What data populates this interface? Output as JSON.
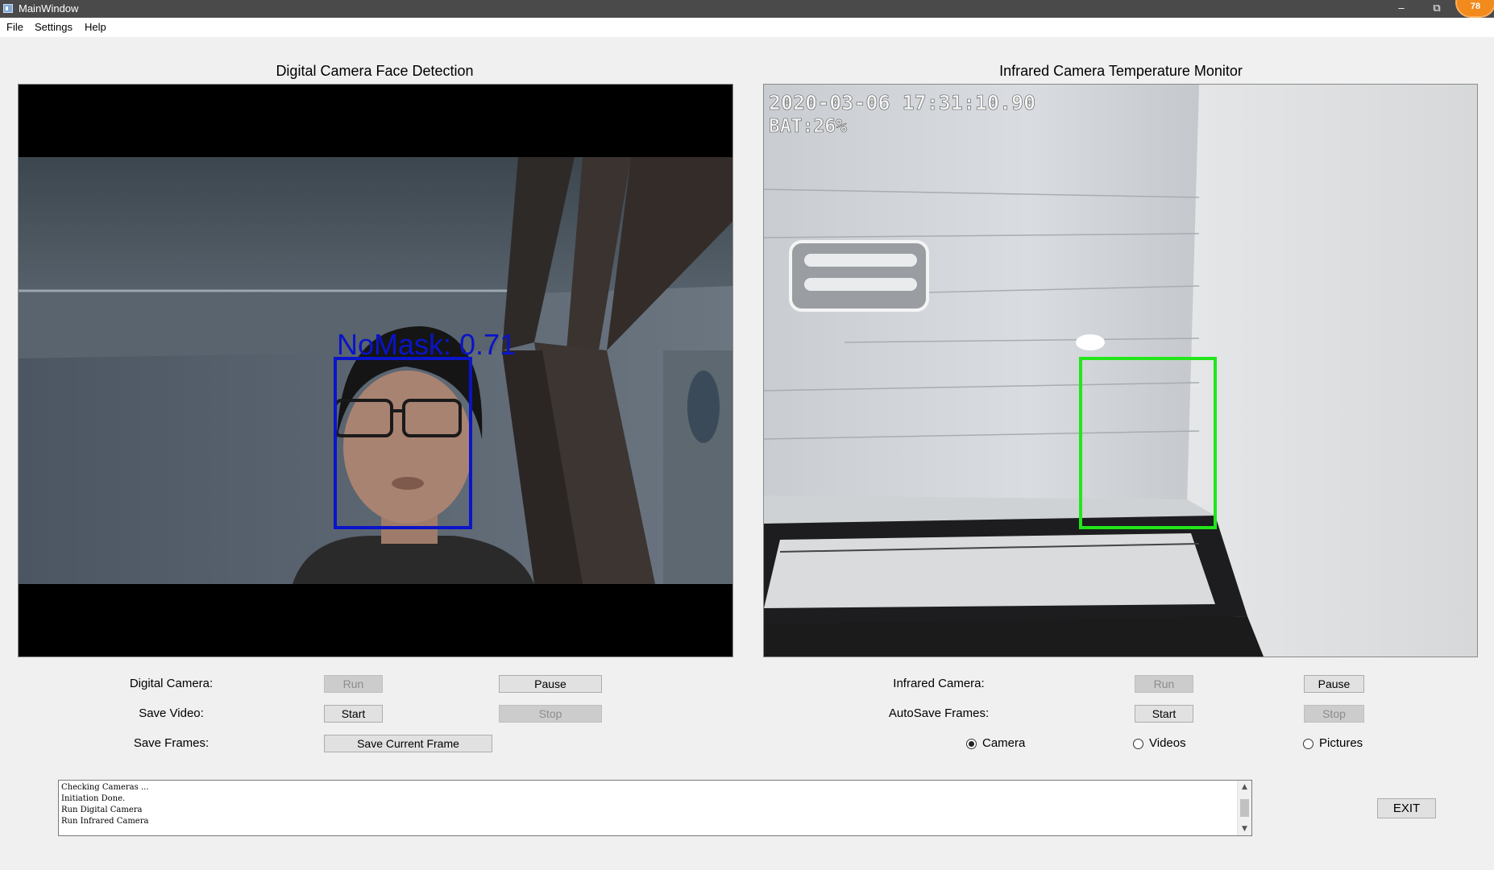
{
  "window": {
    "title": "MainWindow",
    "notification_count": "78"
  },
  "menu": [
    "File",
    "Settings",
    "Help"
  ],
  "digital": {
    "panel_title": "Digital Camera Face Detection",
    "detection_label": "NoMask: 0.71",
    "rows": {
      "camera_label": "Digital Camera:",
      "save_video_label": "Save Video:",
      "save_frames_label": "Save Frames:"
    },
    "buttons": {
      "run": "Run",
      "pause": "Pause",
      "start": "Start",
      "stop": "Stop",
      "save_current_frame": "Save Current Frame"
    }
  },
  "infrared": {
    "panel_title": "Infrared Camera Temperature Monitor",
    "osd_timestamp": "2020-03-06 17:31:10.90",
    "osd_battery": "BAT:26%",
    "rows": {
      "camera_label": "Infrared Camera:",
      "autosave_label": "AutoSave Frames:"
    },
    "buttons": {
      "run": "Run",
      "pause": "Pause",
      "start": "Start",
      "stop": "Stop"
    },
    "radio_options": [
      {
        "label": "Camera",
        "checked": true
      },
      {
        "label": "Videos",
        "checked": false
      },
      {
        "label": "Pictures",
        "checked": false
      }
    ]
  },
  "log": {
    "lines": [
      "Checking Cameras ...",
      "Initiation Done.",
      "Run Digital Camera",
      "Run Infrared Camera"
    ]
  },
  "exit_button": "EXIT",
  "colors": {
    "face_box": "#0a14c8",
    "temperature_box": "#22e61a",
    "disabled_text": "#8c8c8c"
  }
}
